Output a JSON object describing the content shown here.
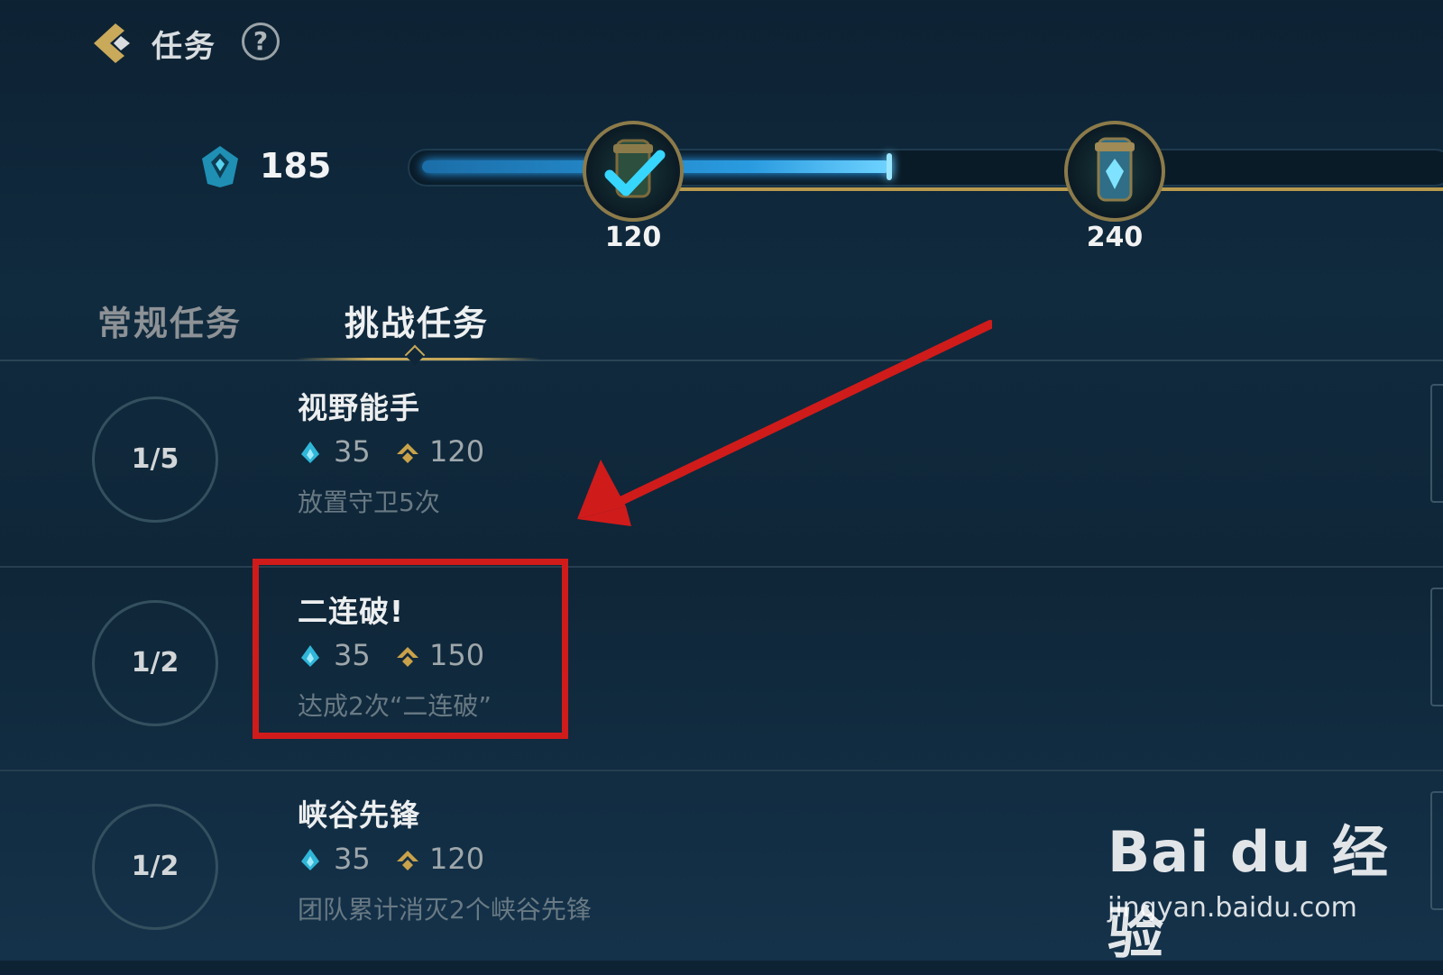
{
  "header": {
    "title": "任务",
    "help_symbol": "?"
  },
  "points": {
    "value": "185"
  },
  "milestones": [
    {
      "value": "120",
      "claimed": true
    },
    {
      "value": "240",
      "claimed": false
    }
  ],
  "tabs": [
    {
      "label": "常规任务",
      "active": false
    },
    {
      "label": "挑战任务",
      "active": true
    }
  ],
  "tasks": [
    {
      "name": "视野能手",
      "progress": "1/5",
      "reward_a": "35",
      "reward_b": "120",
      "desc": "放置守卫5次"
    },
    {
      "name": "二连破!",
      "progress": "1/2",
      "reward_a": "35",
      "reward_b": "150",
      "desc": "达成2次“二连破”"
    },
    {
      "name": "峡谷先锋",
      "progress": "1/2",
      "reward_a": "35",
      "reward_b": "120",
      "desc": "团队累计消灭2个峡谷先锋"
    }
  ],
  "colors": {
    "accent_gold": "#c6a85a",
    "accent_blue": "#2a9be0",
    "annotation_red": "#d01b1b"
  },
  "watermark": {
    "logo_text": "Bai du 经验",
    "url": "jingyan.baidu.com"
  }
}
